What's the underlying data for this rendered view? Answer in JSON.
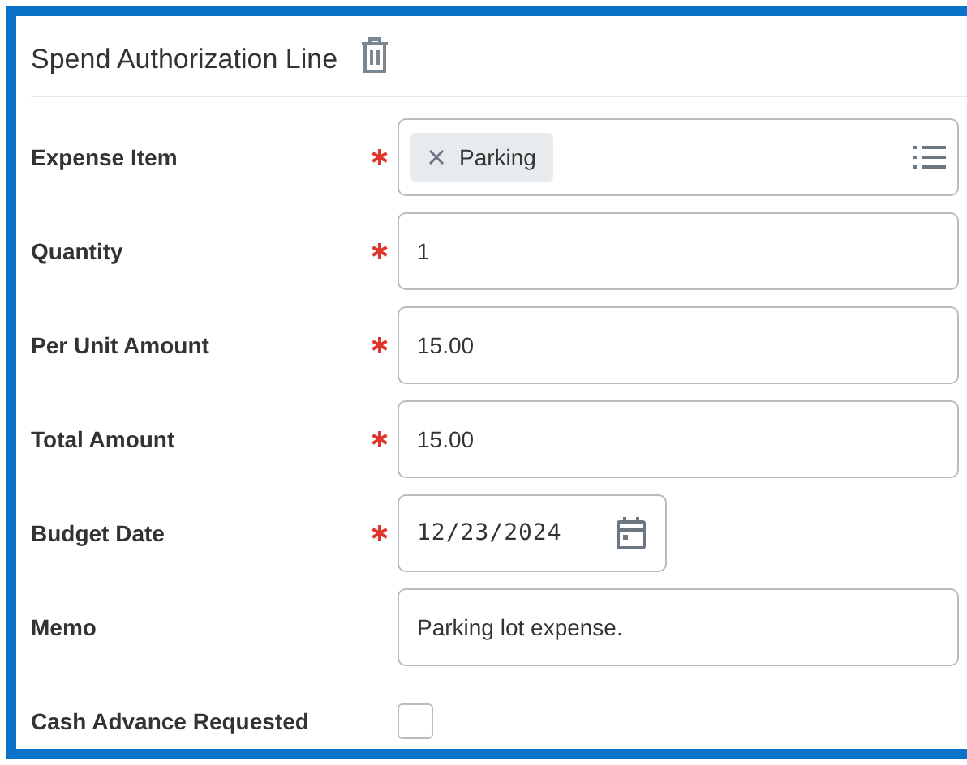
{
  "title": "Spend Authorization Line",
  "fields": [
    {
      "label": "Expense Item",
      "required": true,
      "kind": "multiselect",
      "chips": [
        "Parking"
      ]
    },
    {
      "label": "Quantity",
      "required": true,
      "kind": "text",
      "value": "1"
    },
    {
      "label": "Per Unit Amount",
      "required": true,
      "kind": "text",
      "value": "15.00"
    },
    {
      "label": "Total Amount",
      "required": true,
      "kind": "text",
      "value": "15.00"
    },
    {
      "label": "Budget Date",
      "required": true,
      "kind": "date",
      "value": "12/23/2024"
    },
    {
      "label": "Memo",
      "required": false,
      "kind": "text",
      "value": "Parking lot expense."
    },
    {
      "label": "Cash Advance Requested",
      "required": false,
      "kind": "checkbox",
      "checked": false
    }
  ]
}
